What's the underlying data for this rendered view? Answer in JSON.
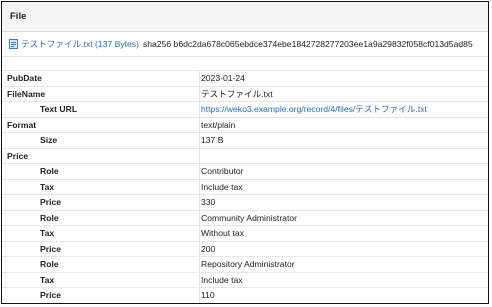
{
  "panel": {
    "title": "File",
    "file_link": "テストファイル.txt (137 Bytes)",
    "hash_text": "sha256 b6dc2da678c065ebdce374ebe1842728277203ee1a9a29832f058cf013d5ad85"
  },
  "rows": [
    {
      "label": "PubDate",
      "value": "2023-01-24"
    },
    {
      "label": "FileName",
      "value": "テストファイル.txt"
    },
    {
      "label": "Text URL",
      "value": "https://weko3.example.org/record/4/files/テストファイル.txt"
    },
    {
      "label": "Format",
      "value": "text/plain"
    },
    {
      "label": "Size",
      "value": "137 B"
    },
    {
      "label": "Price",
      "value": ""
    },
    {
      "label": "Role",
      "value": "Contributor"
    },
    {
      "label": "Tax",
      "value": "Include tax"
    },
    {
      "label": "Price",
      "value": "330"
    },
    {
      "label": "Role",
      "value": "Community Administrator"
    },
    {
      "label": "Tax",
      "value": "Without tax"
    },
    {
      "label": "Price",
      "value": "200"
    },
    {
      "label": "Role",
      "value": "Repository Administrator"
    },
    {
      "label": "Tax",
      "value": "Include tax"
    },
    {
      "label": "Price",
      "value": "110"
    }
  ],
  "colors": {
    "link": "#2a6db5",
    "header_bg": "#f5f5f5"
  },
  "icons": {
    "file": "file-icon"
  }
}
